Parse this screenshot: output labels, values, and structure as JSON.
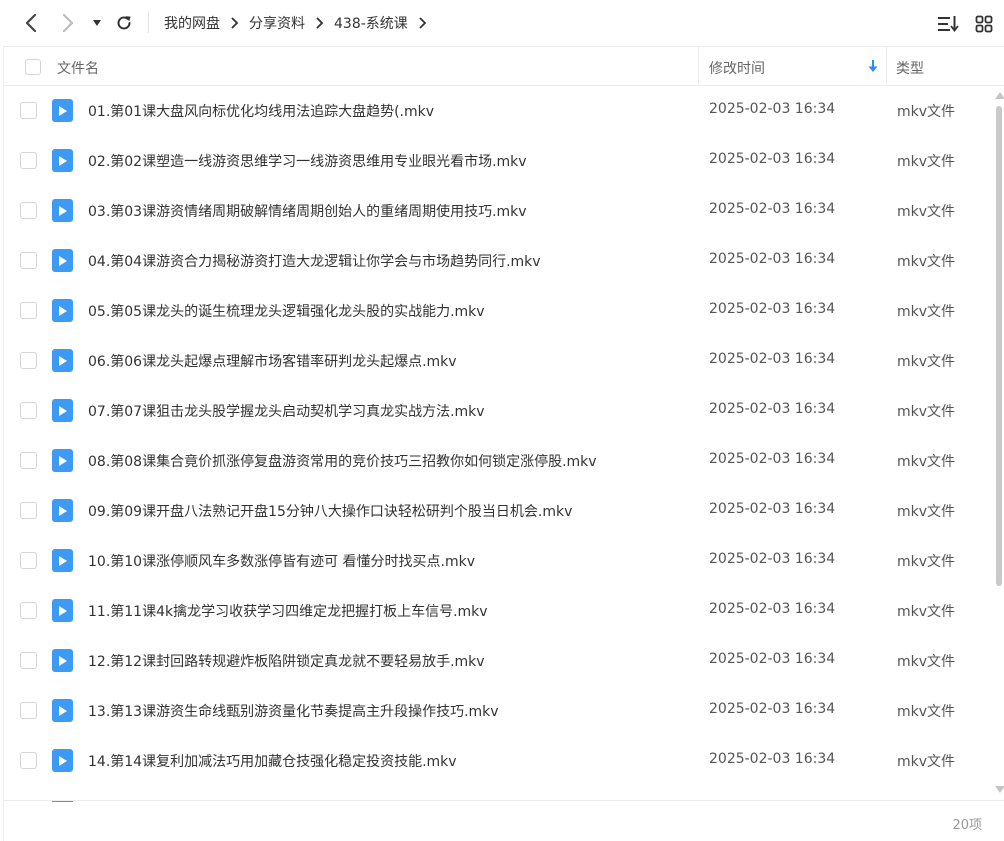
{
  "toolbar": {
    "breadcrumb": [
      "我的网盘",
      "分享资料",
      "438-系统课"
    ]
  },
  "table": {
    "columns": {
      "name": "文件名",
      "modified": "修改时间",
      "type": "类型"
    },
    "rows": [
      {
        "name": "01.第01课大盘风向标优化均线用法追踪大盘趋势(.mkv",
        "modified": "2025-02-03 16:34",
        "type": "mkv文件"
      },
      {
        "name": "02.第02课塑造一线游资思维学习一线游资思维用专业眼光看市场.mkv",
        "modified": "2025-02-03 16:34",
        "type": "mkv文件"
      },
      {
        "name": "03.第03课游资情绪周期破解情绪周期创始人的重绪周期使用技巧.mkv",
        "modified": "2025-02-03 16:34",
        "type": "mkv文件"
      },
      {
        "name": "04.第04课游资合力揭秘游资打造大龙逻辑让你学会与市场趋势同行.mkv",
        "modified": "2025-02-03 16:34",
        "type": "mkv文件"
      },
      {
        "name": "05.第05课龙头的诞生梳理龙头逻辑强化龙头股的实战能力.mkv",
        "modified": "2025-02-03 16:34",
        "type": "mkv文件"
      },
      {
        "name": "06.第06课龙头起爆点理解市场客错率研判龙头起爆点.mkv",
        "modified": "2025-02-03 16:34",
        "type": "mkv文件"
      },
      {
        "name": "07.第07课狙击龙头股学握龙头启动契机学习真龙实战方法.mkv",
        "modified": "2025-02-03 16:34",
        "type": "mkv文件"
      },
      {
        "name": "08.第08课集合竟价抓涨停复盘游资常用的竞价技巧三招教你如何锁定涨停股.mkv",
        "modified": "2025-02-03 16:34",
        "type": "mkv文件"
      },
      {
        "name": "09.第09课开盘八法熟记开盘15分钟八大操作口诀轻松研判个股当日机会.mkv",
        "modified": "2025-02-03 16:34",
        "type": "mkv文件"
      },
      {
        "name": "10.第10课涨停顺风车多数涨停皆有迹可 看懂分时找买点.mkv",
        "modified": "2025-02-03 16:34",
        "type": "mkv文件"
      },
      {
        "name": "11.第11课4k擒龙学习收获学习四维定龙把握打板上车信号.mkv",
        "modified": "2025-02-03 16:34",
        "type": "mkv文件"
      },
      {
        "name": "12.第12课封回路转规避炸板陷阱锁定真龙就不要轻易放手.mkv",
        "modified": "2025-02-03 16:34",
        "type": "mkv文件"
      },
      {
        "name": "13.第13课游资生命线甄别游资量化节奏提高主升段操作技巧.mkv",
        "modified": "2025-02-03 16:34",
        "type": "mkv文件"
      },
      {
        "name": "14.第14课复利加减法巧用加藏仓技强化稳定投资技能.mkv",
        "modified": "2025-02-03 16:34",
        "type": "mkv文件"
      }
    ]
  },
  "footer": {
    "count": "20项"
  },
  "colors": {
    "accent": "#3d9bf5",
    "border": "#ececec",
    "text": "#333333"
  },
  "icons": [
    "back-arrow-icon",
    "forward-arrow-icon",
    "dropdown-triangle-icon",
    "refresh-icon",
    "chevron-right-icon",
    "sort-list-icon",
    "grid-view-icon",
    "sort-down-arrow-icon",
    "video-file-icon"
  ]
}
